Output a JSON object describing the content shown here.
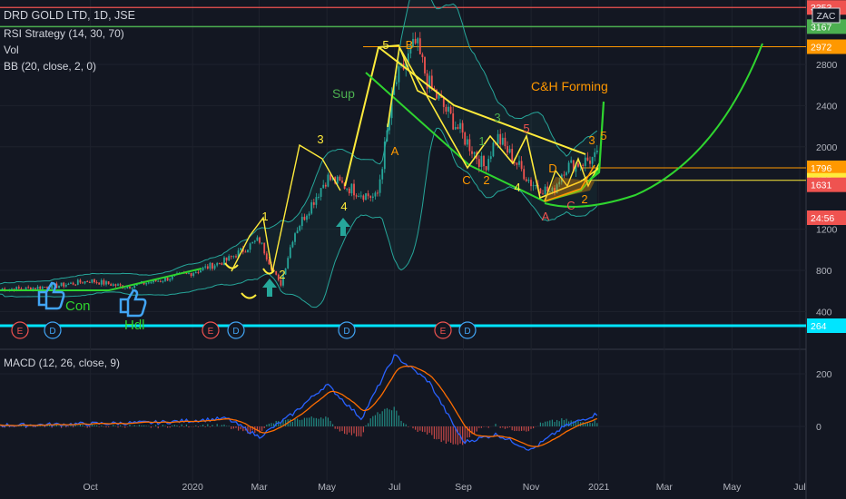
{
  "header": {
    "title": "DRD GOLD LTD, 1D, JSE",
    "indicators": [
      "RSI Strategy (14, 30, 70)",
      "Vol",
      "BB (20, close, 2, 0)"
    ],
    "macd_label": "MACD (12, 26, close, 9)"
  },
  "colors": {
    "background": "#131722",
    "up": "#26a69a",
    "down": "#ef5350",
    "bb": "#26a69a",
    "yellow": "#ffeb3b",
    "green": "#4caf50",
    "lime": "#2fd52f",
    "orange": "#ff9800",
    "cyan": "#00e5ff",
    "macd": "#2962ff",
    "signal": "#ff6d00"
  },
  "chart_data": [
    {
      "type": "candlestick",
      "title": "DRD GOLD LTD, 1D, JSE",
      "x_ticks": [
        "Oct",
        "2020",
        "Mar",
        "May",
        "Jul",
        "Sep",
        "Nov",
        "2021",
        "Mar",
        "May",
        "Jul"
      ],
      "y_ticks": [
        400,
        800,
        1200,
        2000,
        2400,
        2800
      ],
      "ylim": [
        200,
        3300
      ],
      "price_labels": [
        {
          "text": "3353",
          "value": 3353,
          "color": "#ef5350"
        },
        {
          "text": "3167",
          "value": 3167,
          "color": "#4caf50"
        },
        {
          "text": "2972",
          "value": 2972,
          "color": "#ff9800"
        },
        {
          "text": "1796",
          "value": 1796,
          "color": "#ff9800"
        },
        {
          "text": "1675",
          "value": 1675,
          "color": "#ffeb3b"
        },
        {
          "text": "1631",
          "value": 1631,
          "color": "#ef5350"
        },
        {
          "text": "24:56",
          "value": 1500,
          "color": "#ef5350"
        },
        {
          "text": "264",
          "value": 264,
          "color": "#00e5ff"
        }
      ],
      "symbol_badge": "ZAC",
      "price_path": [
        [
          "2019-08",
          620
        ],
        [
          "2019-09",
          650
        ],
        [
          "2019-10",
          700
        ],
        [
          "2019-11",
          640
        ],
        [
          "2019-12",
          700
        ],
        [
          "2020-01",
          780
        ],
        [
          "2020-02",
          900
        ],
        [
          "2020-03-01",
          1100
        ],
        [
          "2020-03-20",
          650
        ],
        [
          "2020-04",
          1150
        ],
        [
          "2020-05",
          1700
        ],
        [
          "2020-06",
          1550
        ],
        [
          "2020-06-15",
          1500
        ],
        [
          "2020-07",
          2600
        ],
        [
          "2020-07-20",
          3000
        ],
        [
          "2020-08",
          2600
        ],
        [
          "2020-09",
          2100
        ],
        [
          "2020-09-20",
          1800
        ],
        [
          "2020-10",
          2100
        ],
        [
          "2020-11",
          1650
        ],
        [
          "2020-11-20",
          1550
        ],
        [
          "2020-12",
          1800
        ],
        [
          "2021-01",
          1900
        ],
        [
          "2021-01-10",
          1631
        ]
      ],
      "wave_labels": [
        {
          "text": "1",
          "color": "#ffeb3b"
        },
        {
          "text": "2",
          "color": "#ffeb3b"
        },
        {
          "text": "3",
          "color": "#ffeb3b"
        },
        {
          "text": "4",
          "color": "#ffeb3b"
        },
        {
          "text": "5",
          "color": "#ffeb3b"
        },
        {
          "text": "A",
          "color": "#ff9800"
        },
        {
          "text": "B",
          "color": "#ff9800"
        },
        {
          "text": "C",
          "color": "#ff9800"
        },
        {
          "text": "1",
          "color": "#4caf50"
        },
        {
          "text": "2",
          "color": "#ff9800"
        },
        {
          "text": "3",
          "color": "#4caf50"
        },
        {
          "text": "4",
          "color": "#ffeb3b"
        },
        {
          "text": "5",
          "color": "#ef5350"
        },
        {
          "text": "A",
          "color": "#ef5350"
        },
        {
          "text": "C",
          "color": "#ef5350"
        },
        {
          "text": "D",
          "color": "#ff9800"
        },
        {
          "text": "2",
          "color": "#ff9800"
        },
        {
          "text": "3",
          "color": "#ff9800"
        },
        {
          "text": "5",
          "color": "#ff9800"
        }
      ],
      "annotations": [
        {
          "text": "Sup",
          "color": "#4caf50"
        },
        {
          "text": "C&H  Forming",
          "color": "#ff9800"
        },
        {
          "text": "Con",
          "color": "#2fd52f"
        },
        {
          "text": "Hdl",
          "color": "#2fd52f"
        }
      ],
      "event_markers": [
        "E",
        "D",
        "E",
        "D",
        "D",
        "E",
        "D"
      ]
    },
    {
      "type": "bar",
      "title": "MACD (12, 26, close, 9)",
      "y_ticks": [
        200,
        0
      ],
      "ylim": [
        -200,
        260
      ],
      "macd_path": [
        [
          "2019-08",
          5
        ],
        [
          "2019-10",
          10
        ],
        [
          "2019-12",
          15
        ],
        [
          "2020-02",
          30
        ],
        [
          "2020-03",
          -40
        ],
        [
          "2020-04",
          50
        ],
        [
          "2020-05",
          160
        ],
        [
          "2020-06",
          30
        ],
        [
          "2020-07",
          270
        ],
        [
          "2020-08",
          170
        ],
        [
          "2020-09",
          -60
        ],
        [
          "2020-10",
          -30
        ],
        [
          "2020-11",
          -90
        ],
        [
          "2020-12",
          0
        ],
        [
          "2021-01",
          50
        ],
        [
          "2021-01-10",
          0
        ]
      ]
    }
  ]
}
